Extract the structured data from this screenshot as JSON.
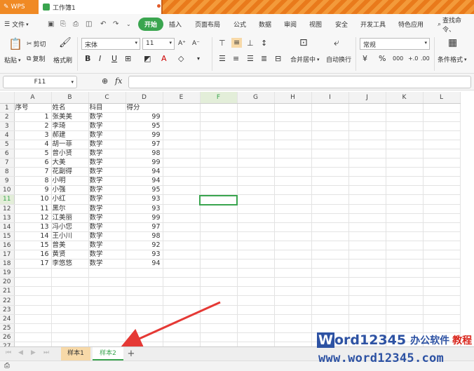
{
  "titlebar": {
    "app": "WPS",
    "doc_tab": "工作簿1"
  },
  "menu": {
    "file": "文件",
    "start": "开始",
    "items": [
      "插入",
      "页面布局",
      "公式",
      "数据",
      "审阅",
      "视图",
      "安全",
      "开发工具",
      "特色应用"
    ],
    "search": "查找命令、"
  },
  "ribbon": {
    "paste": "粘贴",
    "cut": "剪切",
    "copy": "复制",
    "format_painter": "格式刷",
    "font_name": "宋体",
    "font_size": "11",
    "bold": "B",
    "italic": "I",
    "underline": "U",
    "merge": "合并居中",
    "wrap": "自动换行",
    "number_format": "常规",
    "cond_format": "条件格式"
  },
  "formula_bar": {
    "name_box": "F11",
    "fx": "fx",
    "value": ""
  },
  "columns": [
    "A",
    "B",
    "C",
    "D",
    "E",
    "F",
    "G",
    "H",
    "I",
    "J",
    "K",
    "L"
  ],
  "row_numbers": [
    "1",
    "2",
    "3",
    "4",
    "5",
    "6",
    "7",
    "8",
    "9",
    "10",
    "11",
    "12",
    "13",
    "14",
    "15",
    "16",
    "17",
    "18",
    "19",
    "20",
    "21",
    "22",
    "23",
    "24",
    "25",
    "26",
    "27"
  ],
  "header_row": {
    "a": "序号",
    "b": "姓名",
    "c": "科目",
    "d": "得分"
  },
  "rows": [
    {
      "a": "1",
      "b": "张美美",
      "c": "数学",
      "d": "99"
    },
    {
      "a": "2",
      "b": "李琦",
      "c": "数学",
      "d": "95"
    },
    {
      "a": "3",
      "b": "郝建",
      "c": "数学",
      "d": "99"
    },
    {
      "a": "4",
      "b": "胡一菲",
      "c": "数学",
      "d": "97"
    },
    {
      "a": "5",
      "b": "曾小贤",
      "c": "数学",
      "d": "98"
    },
    {
      "a": "6",
      "b": "大美",
      "c": "数学",
      "d": "99"
    },
    {
      "a": "7",
      "b": "花副得",
      "c": "数学",
      "d": "94"
    },
    {
      "a": "8",
      "b": "小明",
      "c": "数学",
      "d": "94"
    },
    {
      "a": "9",
      "b": "小强",
      "c": "数学",
      "d": "95"
    },
    {
      "a": "10",
      "b": "小红",
      "c": "数学",
      "d": "93"
    },
    {
      "a": "11",
      "b": "黑尔",
      "c": "数学",
      "d": "93"
    },
    {
      "a": "12",
      "b": "江美丽",
      "c": "数学",
      "d": "99"
    },
    {
      "a": "13",
      "b": "冯小您",
      "c": "数学",
      "d": "97"
    },
    {
      "a": "14",
      "b": "王小川",
      "c": "数学",
      "d": "98"
    },
    {
      "a": "15",
      "b": "曾美",
      "c": "数学",
      "d": "92"
    },
    {
      "a": "16",
      "b": "黄贤",
      "c": "数学",
      "d": "93"
    },
    {
      "a": "17",
      "b": "李悠悠",
      "c": "数学",
      "d": "94"
    }
  ],
  "selected_cell": "F11",
  "sheets": {
    "sheet1": "样本1",
    "sheet2": "样本2",
    "add": "+"
  },
  "watermark": {
    "brand_w": "W",
    "brand_rest": "ord",
    "digits": "12345",
    "cn_main": "办公软件",
    "cn_red": "教程",
    "url": "www.word12345.com"
  },
  "colors": {
    "accent": "#3aa54f",
    "titlebar": "#f08a24",
    "arrow": "#e53935"
  }
}
